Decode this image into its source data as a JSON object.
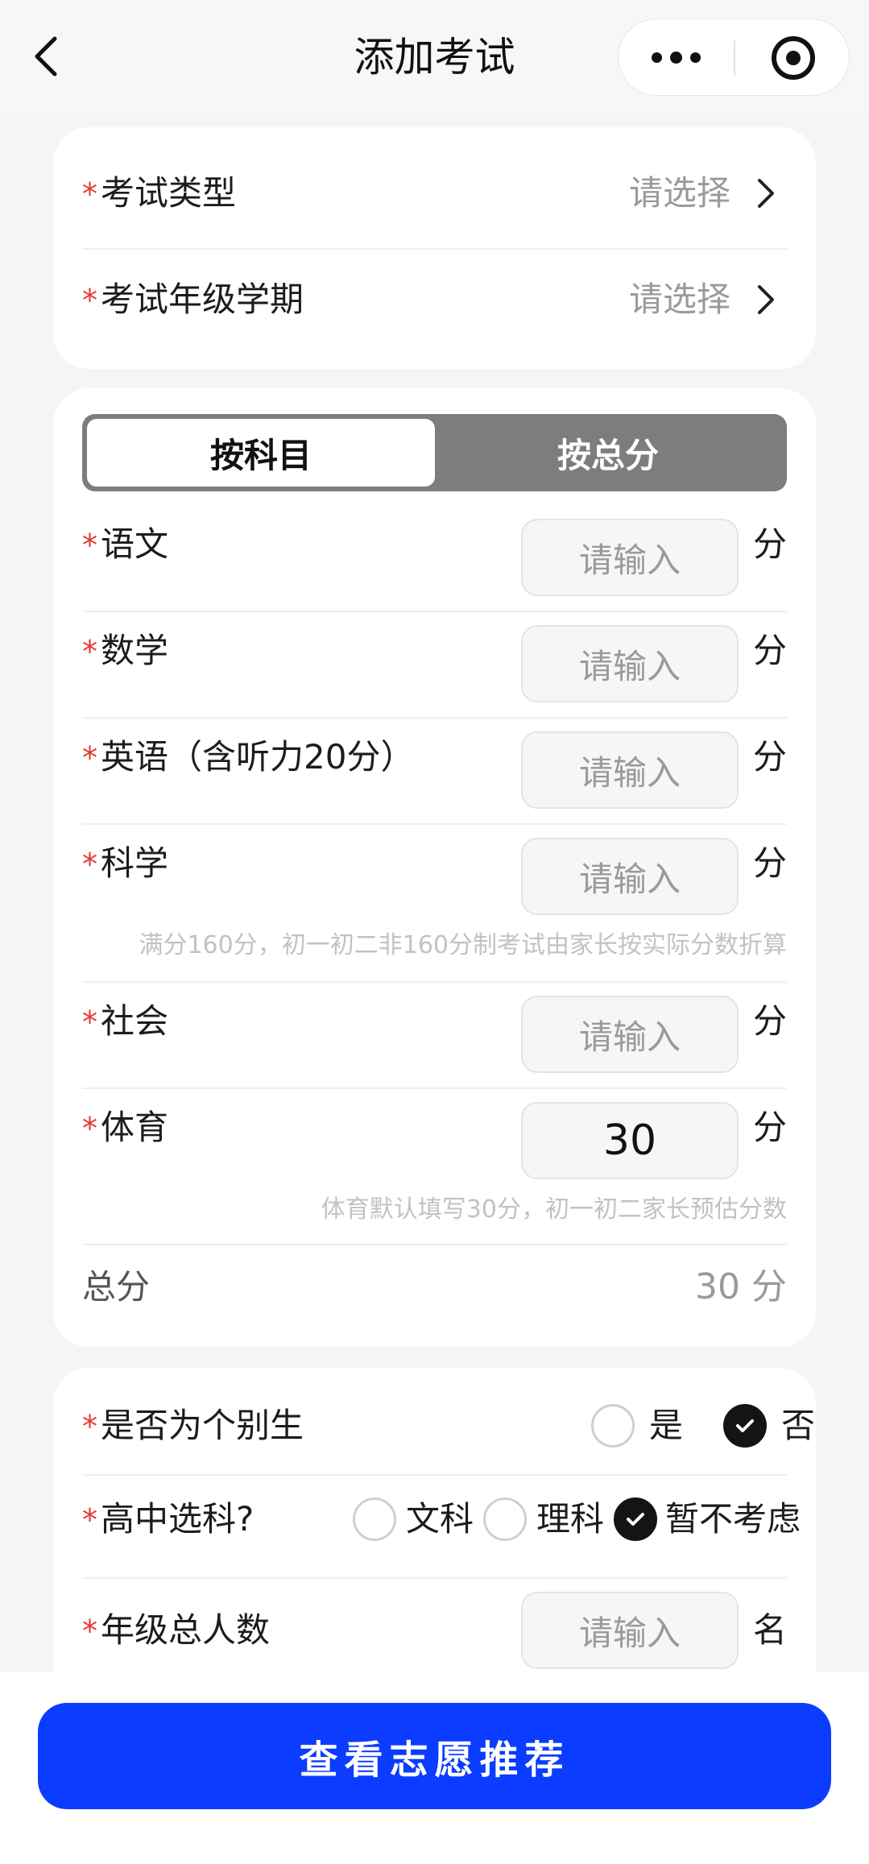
{
  "header": {
    "title": "添加考试",
    "back_icon": "chevron-left-icon",
    "more_icon": "more-dots-icon",
    "target_icon": "target-icon"
  },
  "exam_info": {
    "type": {
      "required": "*",
      "label": "考试类型",
      "value": "请选择"
    },
    "grade_term": {
      "required": "*",
      "label": "考试年级学期",
      "value": "请选择"
    }
  },
  "score_mode": {
    "tabs": [
      "按科目",
      "按总分"
    ],
    "active": "按科目"
  },
  "subjects": [
    {
      "required": "*",
      "label": "语文",
      "placeholder": "请输入",
      "unit": "分"
    },
    {
      "required": "*",
      "label": "数学",
      "placeholder": "请输入",
      "unit": "分"
    },
    {
      "required": "*",
      "label": "英语（含听力20分）",
      "placeholder": "请输入",
      "unit": "分"
    },
    {
      "required": "*",
      "label": "科学",
      "placeholder": "请输入",
      "unit": "分",
      "hint": "满分160分，初一初二非160分制考试由家长按实际分数折算"
    },
    {
      "required": "*",
      "label": "社会",
      "placeholder": "请输入",
      "unit": "分"
    },
    {
      "required": "*",
      "label": "体育",
      "value": "30",
      "unit": "分",
      "hint": "体育默认填写30分，初一初二家长预估分数"
    }
  ],
  "total": {
    "label": "总分",
    "value": "30 分"
  },
  "individual_student": {
    "required": "*",
    "label": "是否为个别生",
    "options": [
      "是",
      "否"
    ],
    "selected": "否"
  },
  "subject_track": {
    "required": "*",
    "label": "高中选科?",
    "options": [
      "文科",
      "理科",
      "暂不考虑"
    ],
    "selected": "暂不考虑"
  },
  "grade_count": {
    "required": "*",
    "label": "年级总人数",
    "placeholder": "请输入",
    "unit": "名"
  },
  "cta": {
    "label": "查看志愿推荐",
    "color": "#0c3cff"
  },
  "colors": {
    "required": "#e53935",
    "accent": "#0c3cff",
    "checked": "#141414"
  }
}
